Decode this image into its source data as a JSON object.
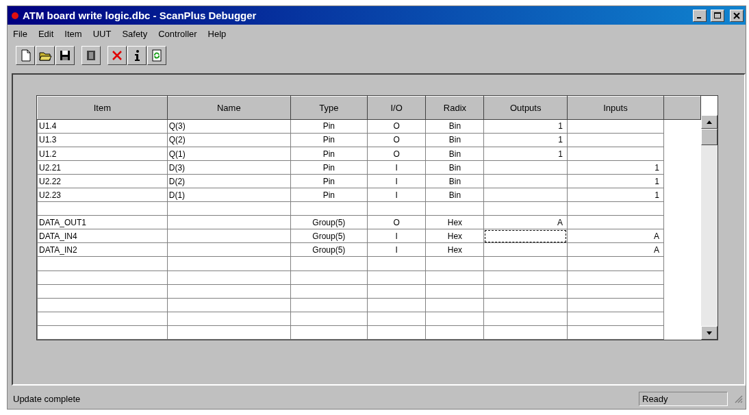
{
  "window": {
    "title": "ATM board write logic.dbc - ScanPlus Debugger"
  },
  "menu": [
    "File",
    "Edit",
    "Item",
    "UUT",
    "Safety",
    "Controller",
    "Help"
  ],
  "table": {
    "columns": [
      "Item",
      "Name",
      "Type",
      "I/O",
      "Radix",
      "Outputs",
      "Inputs"
    ],
    "rows": [
      {
        "kind": "entry",
        "item": "U1.4",
        "name": "Q(3)",
        "type": "Pin",
        "io": "O",
        "radix": "Bin",
        "outputs": "1",
        "focused": false
      },
      {
        "kind": "entry",
        "item": "U1.3",
        "name": "Q(2)",
        "type": "Pin",
        "io": "O",
        "radix": "Bin",
        "outputs": "1",
        "focused": false
      },
      {
        "kind": "entry",
        "item": "U1.2",
        "name": "Q(1)",
        "type": "Pin",
        "io": "O",
        "radix": "Bin",
        "outputs": "1",
        "focused": false
      },
      {
        "kind": "entry",
        "item": "U2.21",
        "name": "D(3)",
        "type": "Pin",
        "io": "I",
        "radix": "Bin",
        "inputs": "1",
        "focused": false
      },
      {
        "kind": "entry",
        "item": "U2.22",
        "name": "D(2)",
        "type": "Pin",
        "io": "I",
        "radix": "Bin",
        "inputs": "1",
        "focused": false
      },
      {
        "kind": "entry",
        "item": "U2.23",
        "name": "D(1)",
        "type": "Pin",
        "io": "I",
        "radix": "Bin",
        "inputs": "1",
        "focused": false
      },
      {
        "kind": "blank"
      },
      {
        "kind": "entry",
        "item": "DATA_OUT1",
        "type": "Group(5)",
        "io": "O",
        "radix": "Hex",
        "outputs": "A",
        "focused": false
      },
      {
        "kind": "entry",
        "item": "DATA_IN4",
        "type": "Group(5)",
        "io": "I",
        "radix": "Hex",
        "inputs": "A",
        "focused": true
      },
      {
        "kind": "entry",
        "item": "DATA_IN2",
        "type": "Group(5)",
        "io": "I",
        "radix": "Hex",
        "inputs": "A",
        "focused": false
      },
      {
        "kind": "blank"
      },
      {
        "kind": "blank"
      },
      {
        "kind": "blank"
      },
      {
        "kind": "blank"
      },
      {
        "kind": "blank"
      },
      {
        "kind": "blank"
      }
    ]
  },
  "status_bar": {
    "message": "Update complete",
    "state": "Ready"
  }
}
